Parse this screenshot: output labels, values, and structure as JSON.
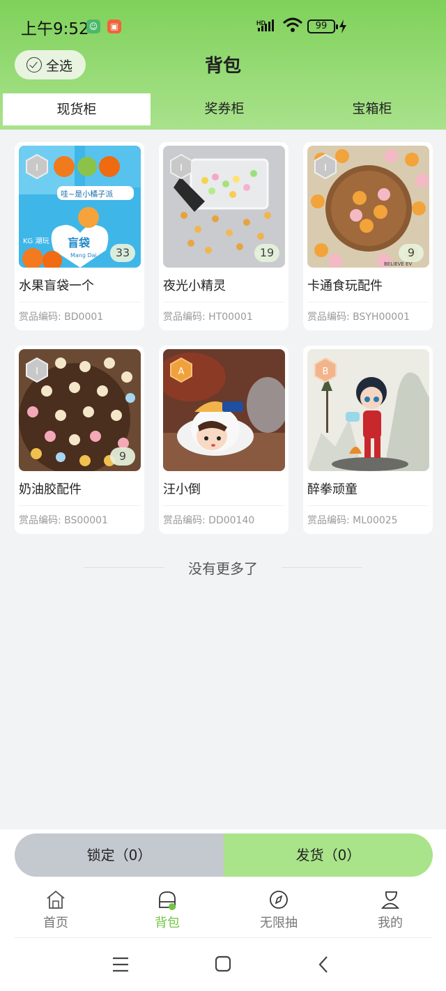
{
  "status_bar": {
    "time": "上午9:52",
    "battery": "99",
    "network": "HD"
  },
  "header": {
    "select_all_label": "全选",
    "title": "背包"
  },
  "tabs": [
    {
      "label": "现货柜",
      "active": true
    },
    {
      "label": "奖券柜",
      "active": false
    },
    {
      "label": "宝箱柜",
      "active": false
    }
  ],
  "items": [
    {
      "name": "水果盲袋一个",
      "code": "赏品编码: BD0001",
      "grade": "I",
      "count": "33"
    },
    {
      "name": "夜光小精灵",
      "code": "赏品编码: HT00001",
      "grade": "I",
      "count": "19"
    },
    {
      "name": "卡通食玩配件",
      "code": "赏品编码: BSYH00001",
      "grade": "I",
      "count": "9"
    },
    {
      "name": "奶油胶配件",
      "code": "赏品编码: BS00001",
      "grade": "I",
      "count": "9"
    },
    {
      "name": "汪小倒",
      "code": "赏品编码: DD00140",
      "grade": "A",
      "count": ""
    },
    {
      "name": "醉拳顽童",
      "code": "赏品编码: ML00025",
      "grade": "B",
      "count": ""
    }
  ],
  "image_texts": {
    "item1_bag": "盲袋",
    "item1_brand": "KG 潮玩",
    "item1_slogan": "哇~是小橘子派",
    "item1_pinyin": "Mang Dai",
    "item3_corner": "BELIEVE EV"
  },
  "list_end_text": "没有更多了",
  "actions": {
    "lock_label": "锁定（0）",
    "ship_label": "发货（0）"
  },
  "bottom_nav": [
    {
      "label": "首页",
      "icon": "home-icon",
      "active": false
    },
    {
      "label": "背包",
      "icon": "backpack-icon",
      "active": true
    },
    {
      "label": "无限抽",
      "icon": "compass-icon",
      "active": false
    },
    {
      "label": "我的",
      "icon": "profile-icon",
      "active": false
    }
  ],
  "colors": {
    "brand_green": "#7fd15a",
    "ship_button": "#a9e38a",
    "lock_button": "#c4c8cf",
    "active_nav": "#72c544",
    "grade_I": "#bfbfbf",
    "grade_A": "#f0a13c",
    "grade_B": "#f2b48a"
  }
}
